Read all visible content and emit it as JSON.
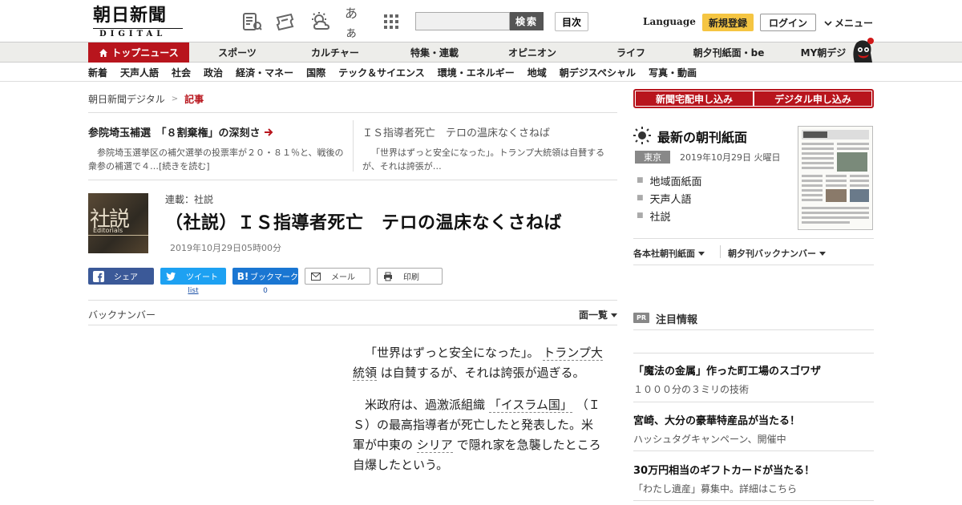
{
  "header": {
    "logo_main": "朝日新聞",
    "logo_sub": "DIGITAL",
    "search_placeholder": "",
    "search_label": "検索",
    "toc_label": "目次",
    "language_label": "Language",
    "register_label": "新規登録",
    "login_label": "ログイン",
    "menu_label": "メニュー",
    "font_size_glyph": "あぁ"
  },
  "nav_primary": [
    {
      "label": "トップニュース",
      "active": true
    },
    {
      "label": "スポーツ"
    },
    {
      "label": "カルチャー"
    },
    {
      "label": "特集・連載"
    },
    {
      "label": "オピニオン"
    },
    {
      "label": "ライフ"
    },
    {
      "label": "朝夕刊紙面・be"
    },
    {
      "label": "MY朝デジ"
    }
  ],
  "nav_secondary": [
    "新着",
    "天声人語",
    "社会",
    "政治",
    "経済・マネー",
    "国際",
    "テック＆サイエンス",
    "環境・エネルギー",
    "地域",
    "朝デジスペシャル",
    "写真・動画"
  ],
  "breadcrumb": {
    "home": "朝日新聞デジタル",
    "sep": ">",
    "current": "記事"
  },
  "related": [
    {
      "title": "参院埼玉補選　「８割棄権」の深刻さ",
      "body": "参院埼玉選挙区の補欠選挙の投票率が２０・８１％と、戦後の衆参の補選で４…[続きを読む]"
    },
    {
      "title": "ＩＳ指導者死亡　テロの温床なくさねば",
      "body": "「世界はずっと安全になった」。トランプ大統領は自賛するが、それは誇張が…"
    }
  ],
  "article": {
    "thumb_kanji": "社説",
    "thumb_en": "Editorials",
    "series": "連載：社説",
    "headline": "（社説）ＩＳ指導者死亡　テロの温床なくさねば",
    "date": "2019年10月29日05時00分",
    "p1_a": "「世界はずっと安全になった」。",
    "p1_link": "トランプ大統領",
    "p1_b": "は自賛するが、それは誇張が過ぎる。",
    "p2_a": "米政府は、過激派組織",
    "p2_link1": "「イスラム国」",
    "p2_b": "（ＩＳ）の最高指導者が死亡したと発表した。米軍が中東の",
    "p2_link2": "シリア",
    "p2_c": "で隠れ家を急襲したところ自爆したという。"
  },
  "share": {
    "facebook": "シェア",
    "twitter": "ツイート",
    "twitter_count": "list",
    "hatena_glyph": "B!",
    "hatena": "ブックマーク",
    "hatena_count": "0",
    "mail": "メール",
    "print": "印刷"
  },
  "backnumber": {
    "label": "バックナンバー",
    "page_list": "面一覧"
  },
  "sidebar": {
    "subscribe_home": "新聞宅配申し込み",
    "subscribe_digital": "デジタル申し込み",
    "latest_title": "最新の朝刊紙面",
    "region": "東京",
    "latest_date": "2019年10月29日 火曜日",
    "links": [
      "地域面紙面",
      "天声人語",
      "社説"
    ],
    "dropdown1": "各本社朝刊紙面",
    "dropdown2": "朝夕刊バックナンバー",
    "pr_badge": "PR",
    "pr_title": "注目情報",
    "pr_items": [
      {
        "title": "「魔法の金属」作った町工場のスゴワザ",
        "sub": "１０００分の３ミリの技術"
      },
      {
        "title": "宮崎、大分の豪華特産品が当たる！",
        "sub": "ハッシュタグキャンペーン、開催中"
      },
      {
        "title": "30万円相当のギフトカードが当たる！",
        "sub": "「わたし遺産」募集中。詳細はこちら"
      }
    ]
  },
  "colors": {
    "brand_red": "#b8151d",
    "register_yellow": "#f5c542",
    "facebook": "#3b5998",
    "twitter": "#1da1f2",
    "hatena": "#1a76d2"
  }
}
